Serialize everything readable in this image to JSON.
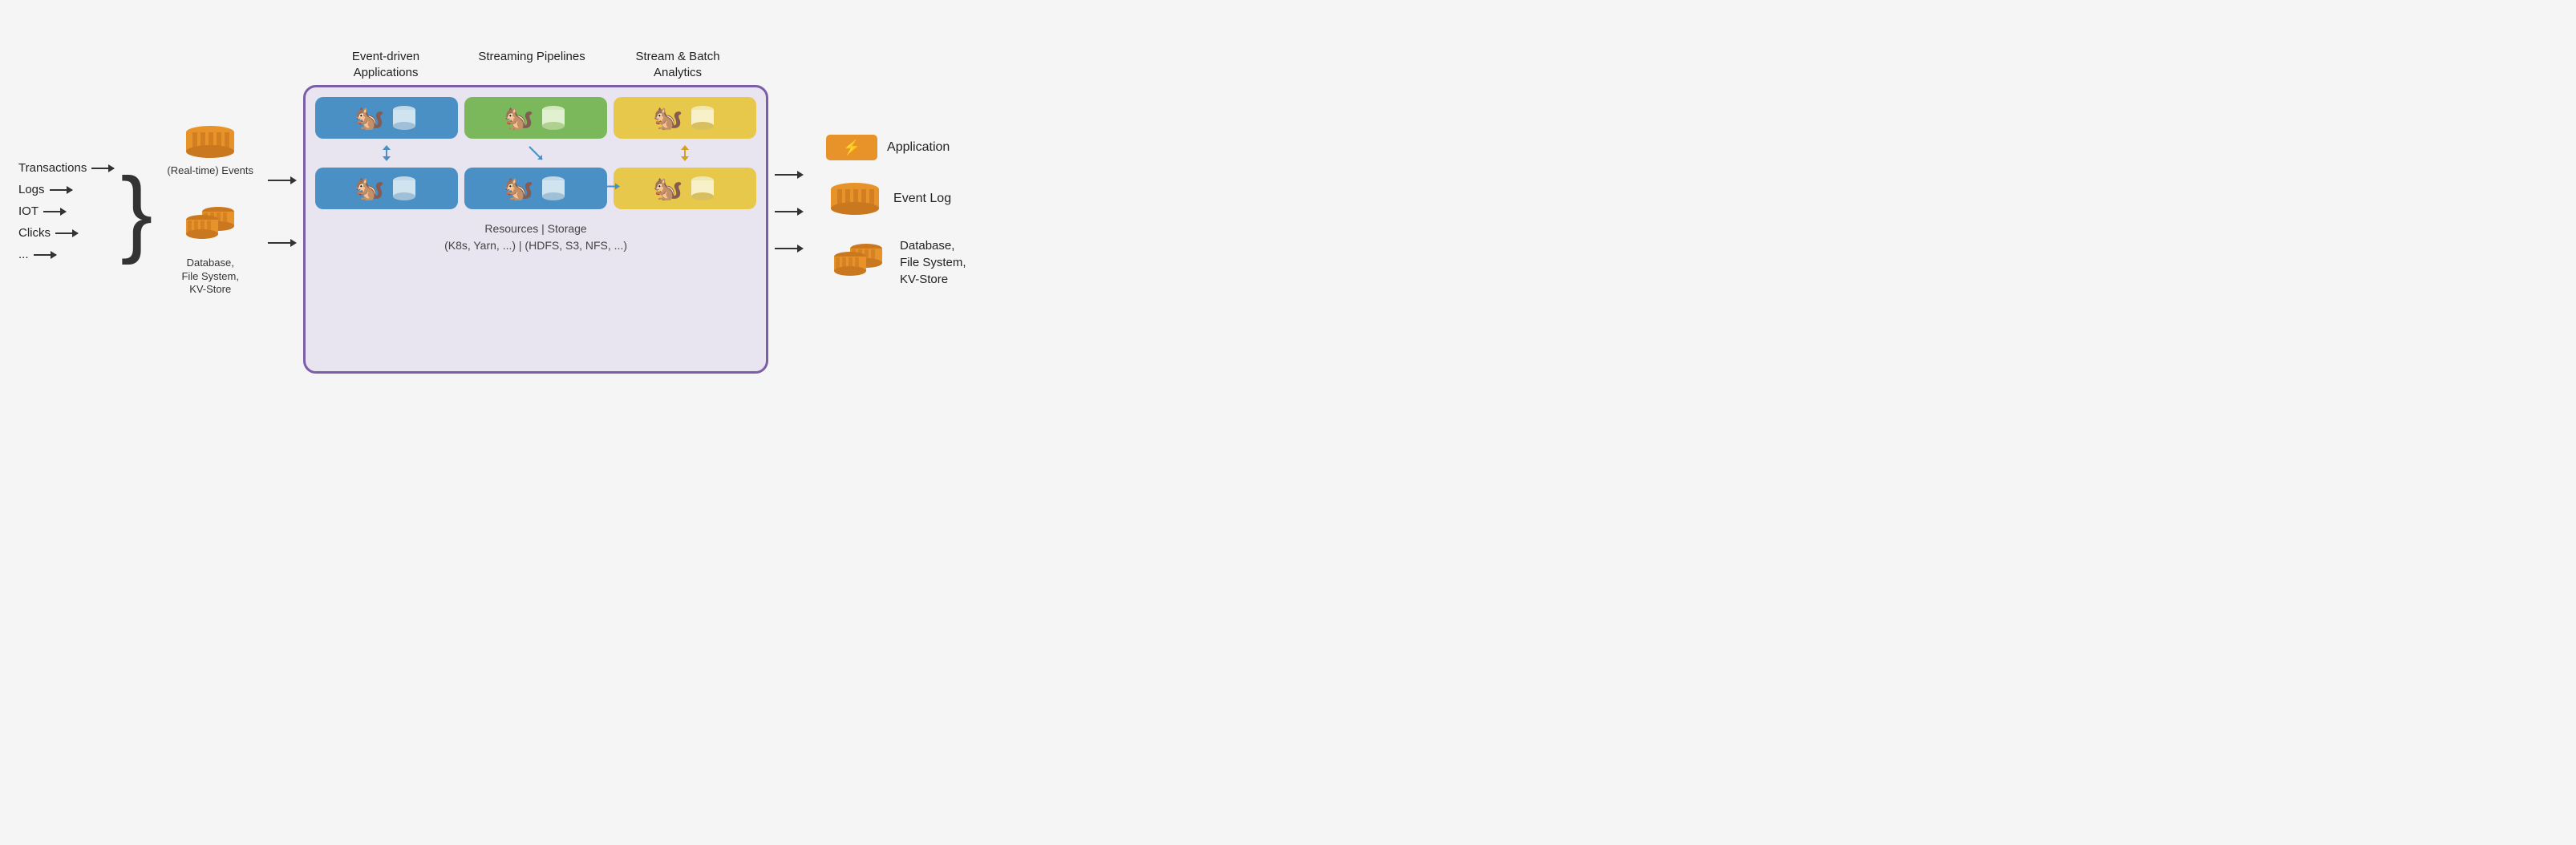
{
  "inputs": {
    "items": [
      "Transactions",
      "Logs",
      "IOT",
      "Clicks",
      "..."
    ]
  },
  "left_labels": {
    "events": "(Real-time)\nEvents",
    "db": "Database,\nFile System,\nKV-Store"
  },
  "headers": {
    "col1": "Event-driven\nApplications",
    "col2": "Streaming\nPipelines",
    "col3": "Stream & Batch\nAnalytics"
  },
  "main_box": {
    "footer_line1": "Resources | Storage",
    "footer_line2": "(K8s, Yarn, ...) | (HDFS, S3, NFS, ...)"
  },
  "outputs": {
    "app_label": "Application",
    "eventlog_label": "Event Log",
    "db_label": "Database,\nFile System,\nKV-Store"
  },
  "icons": {
    "squirrel": "🐿",
    "lightning": "⚡"
  }
}
